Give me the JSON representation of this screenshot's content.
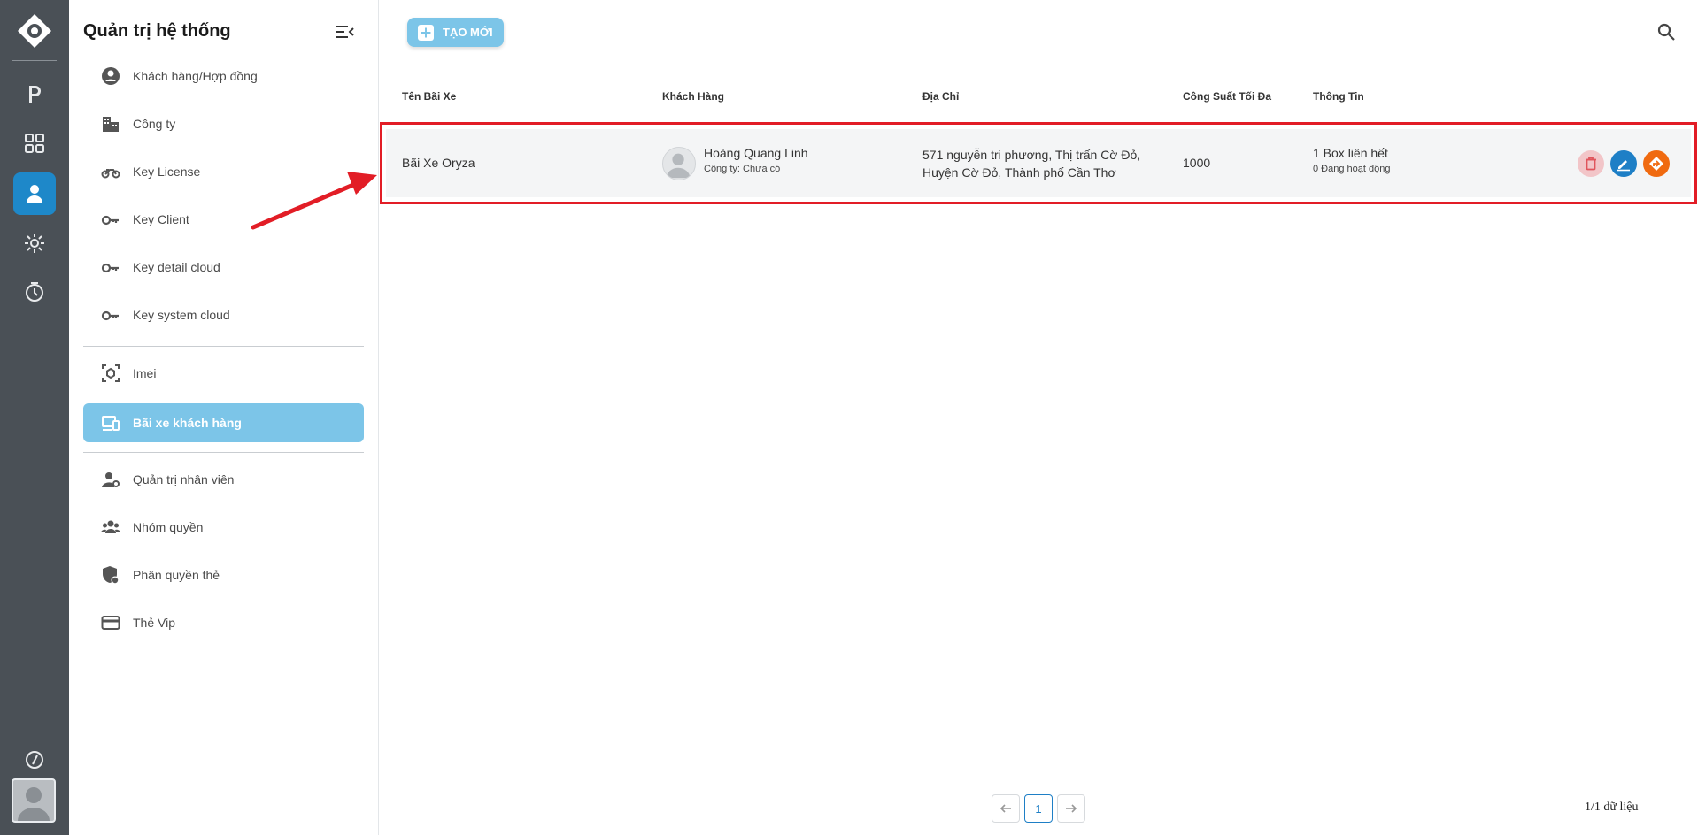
{
  "sidebar": {
    "title": "Quản trị hệ thống",
    "items": [
      {
        "label": "Khách hàng/Hợp đồng",
        "icon": "account-circle-icon"
      },
      {
        "label": "Công ty",
        "icon": "building-icon"
      },
      {
        "label": "Key License",
        "icon": "motorbike-icon"
      },
      {
        "label": "Key Client",
        "icon": "key-icon"
      },
      {
        "label": "Key detail cloud",
        "icon": "key-icon"
      },
      {
        "label": "Key system cloud",
        "icon": "key-icon"
      },
      {
        "label": "Imei",
        "icon": "scan-box-icon"
      },
      {
        "label": "Bãi xe khách hàng",
        "icon": "devices-icon",
        "active": true
      },
      {
        "label": "Quản trị nhân viên",
        "icon": "user-cog-icon"
      },
      {
        "label": "Nhóm quyền",
        "icon": "group-icon"
      },
      {
        "label": "Phân quyền thẻ",
        "icon": "shield-account-icon"
      },
      {
        "label": "Thẻ Vip",
        "icon": "credit-card-icon"
      }
    ]
  },
  "rail": {
    "items": [
      "parking-icon",
      "grid-icon",
      "user-icon",
      "settings-icon",
      "history-icon",
      "help-icon"
    ],
    "active": "user-icon"
  },
  "toolbar": {
    "create_label": "TẠO MỚI"
  },
  "table": {
    "headers": [
      "Tên Bãi Xe",
      "Khách Hàng",
      "Địa Chỉ",
      "Công Suất Tối Đa",
      "Thông Tin"
    ],
    "rows": [
      {
        "name": "Bãi Xe Oryza",
        "customer_name": "Hoàng Quang Linh",
        "customer_company": "Công ty: Chưa có",
        "address_line1": "571 nguyễn tri phương, Thị trấn Cờ Đỏ,",
        "address_line2": "Huyện Cờ Đỏ, Thành phố Cần Thơ",
        "capacity": "1000",
        "info_main": "1 Box liên hết",
        "info_sub": "0 Đang hoạt động"
      }
    ]
  },
  "pagination": {
    "current_page": "1",
    "record_count": "1/1 dữ liệu"
  },
  "colors": {
    "rail_bg": "#4a5056",
    "accent": "#1e88c9",
    "active_nav": "#7cc5e8",
    "highlight": "#e21d26",
    "delete": "#f2c5c8",
    "edit": "#1e7fc6",
    "go": "#f06a10"
  }
}
